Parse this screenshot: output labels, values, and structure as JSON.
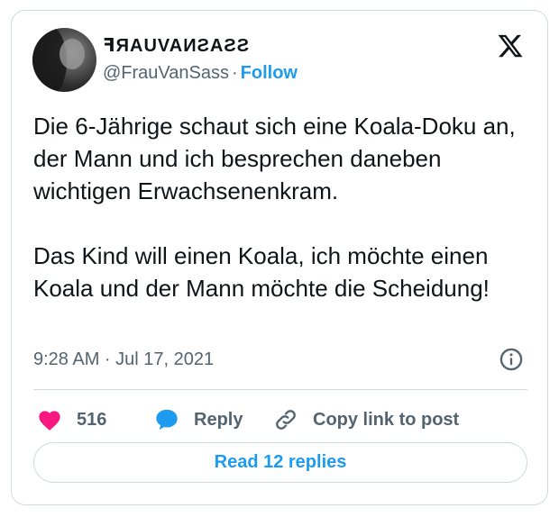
{
  "author": {
    "display_name": "ꟻЯAUVAИƧAƧƧ",
    "handle": "@FrauVanSass",
    "separator": "·",
    "follow_label": "Follow"
  },
  "tweet": {
    "paragraph_1": "Die 6-Jährige schaut sich eine Koala-Doku an, der Mann und ich besprechen daneben wichtigen Erwachsenenkram.",
    "paragraph_2": "Das Kind will einen Koala, ich möchte einen Koala und der Mann möchte die Scheidung!",
    "timestamp": "9:28 AM · Jul 17, 2021"
  },
  "actions": {
    "like_count": "516",
    "reply_label": "Reply",
    "copy_link_label": "Copy link to post"
  },
  "read_replies_label": "Read 12 replies",
  "icons": {
    "brand": "x-logo-icon",
    "info": "info-icon",
    "like": "heart-icon",
    "reply": "speech-bubble-icon",
    "copy": "link-icon"
  },
  "colors": {
    "accent": "#1d9bf0",
    "like": "#f91880",
    "muted_text": "#536471",
    "border": "#cfd9de",
    "text": "#0f1419"
  }
}
